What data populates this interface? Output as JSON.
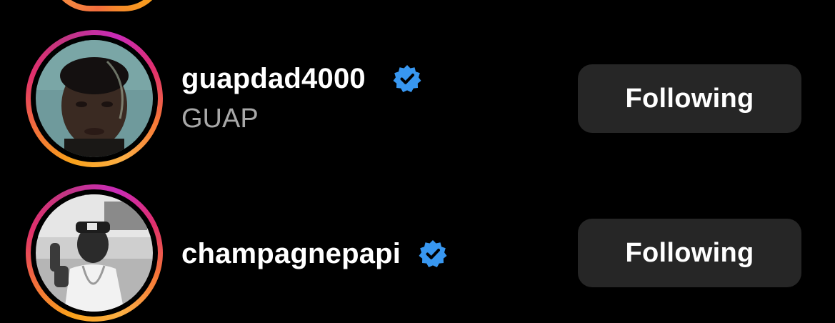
{
  "accounts": [
    {
      "username": "guapdad4000",
      "full_name": "GUAP",
      "verified": true,
      "follow_label": "Following"
    },
    {
      "username": "champagnepapi",
      "full_name": "",
      "verified": true,
      "follow_label": "Following"
    }
  ],
  "colors": {
    "background": "#000000",
    "button_bg": "#262626",
    "verified_badge": "#3897f0",
    "subtitle": "#a8a8a8"
  }
}
